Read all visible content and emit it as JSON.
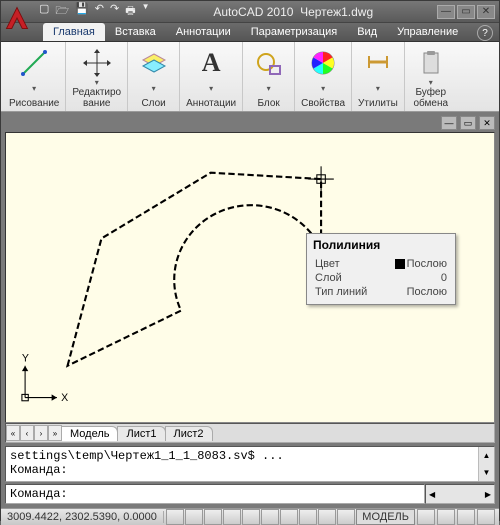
{
  "titlebar": {
    "app": "AutoCAD 2010",
    "file": "Чертеж1.dwg"
  },
  "tabs": [
    "Главная",
    "Вставка",
    "Аннотации",
    "Параметризация",
    "Вид",
    "Управление"
  ],
  "active_tab": 0,
  "ribbon": {
    "groups": [
      {
        "label": "Рисование"
      },
      {
        "label": "Редактиро\nвание"
      },
      {
        "label": "Слои"
      },
      {
        "label": "Аннотации"
      },
      {
        "label": "Блок"
      },
      {
        "label": "Свойства"
      },
      {
        "label": "Утилиты"
      },
      {
        "label": "Буфер\nобмена"
      }
    ]
  },
  "tooltip": {
    "title": "Полилиния",
    "rows": [
      {
        "k": "Цвет",
        "v": "Послою",
        "swatch": true
      },
      {
        "k": "Слой",
        "v": "0"
      },
      {
        "k": "Тип линий",
        "v": "Послою"
      }
    ]
  },
  "model_tabs": [
    "Модель",
    "Лист1",
    "Лист2"
  ],
  "active_model_tab": 0,
  "command": {
    "history": "settings\\temp\\Чертеж1_1_1_8083.sv$ ...\nКоманда:",
    "prompt": "Команда:"
  },
  "status": {
    "coords": "3009.4422, 2302.5390, 0.0000",
    "model_label": "МОДЕЛЬ"
  }
}
